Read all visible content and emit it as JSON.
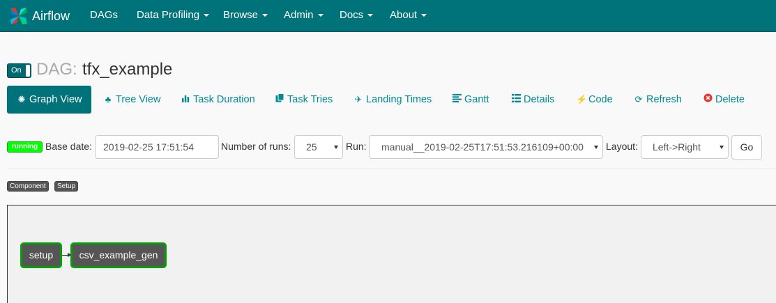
{
  "nav": {
    "brand": "Airflow",
    "items": [
      {
        "label": "DAGs"
      },
      {
        "label": "Data Profiling"
      },
      {
        "label": "Browse"
      },
      {
        "label": "Admin"
      },
      {
        "label": "Docs"
      },
      {
        "label": "About"
      }
    ]
  },
  "dag": {
    "toggle_label": "On",
    "prefix": "DAG:",
    "name": "tfx_example"
  },
  "tabs": [
    {
      "label": "Graph View",
      "icon": "asterisk-icon",
      "active": true
    },
    {
      "label": "Tree View",
      "icon": "tree-icon"
    },
    {
      "label": "Task Duration",
      "icon": "bar-chart-icon"
    },
    {
      "label": "Task Tries",
      "icon": "duplicate-icon"
    },
    {
      "label": "Landing Times",
      "icon": "plane-icon"
    },
    {
      "label": "Gantt",
      "icon": "align-left-icon"
    },
    {
      "label": "Details",
      "icon": "list-icon"
    },
    {
      "label": "Code",
      "icon": "flash-icon"
    },
    {
      "label": "Refresh",
      "icon": "refresh-icon"
    },
    {
      "label": "Delete",
      "icon": "remove-circle-icon"
    }
  ],
  "filters": {
    "state": "running",
    "state_color": "#00ff00",
    "base_date_label": "Base date:",
    "base_date_value": "2019-02-25 17:51:54",
    "num_runs_label": "Number of runs:",
    "num_runs_value": "25",
    "run_label": "Run:",
    "run_value": "manual__2019-02-25T17:51:53.216109+00:00",
    "layout_label": "Layout:",
    "layout_value": "Left->Right",
    "go_label": "Go"
  },
  "legend": [
    "Component",
    "Setup"
  ],
  "graph": {
    "nodes": [
      {
        "id": "setup",
        "label": "setup",
        "status_color": "#0a9d0a"
      },
      {
        "id": "csv_example_gen",
        "label": "csv_example_gen",
        "status_color": "#0a9d0a"
      }
    ],
    "edges": [
      {
        "from": "setup",
        "to": "csv_example_gen"
      }
    ]
  },
  "colors": {
    "navbar": "#00737a",
    "link": "#008b94",
    "running": "#00ff00",
    "node_border": "#0a9d0a"
  }
}
